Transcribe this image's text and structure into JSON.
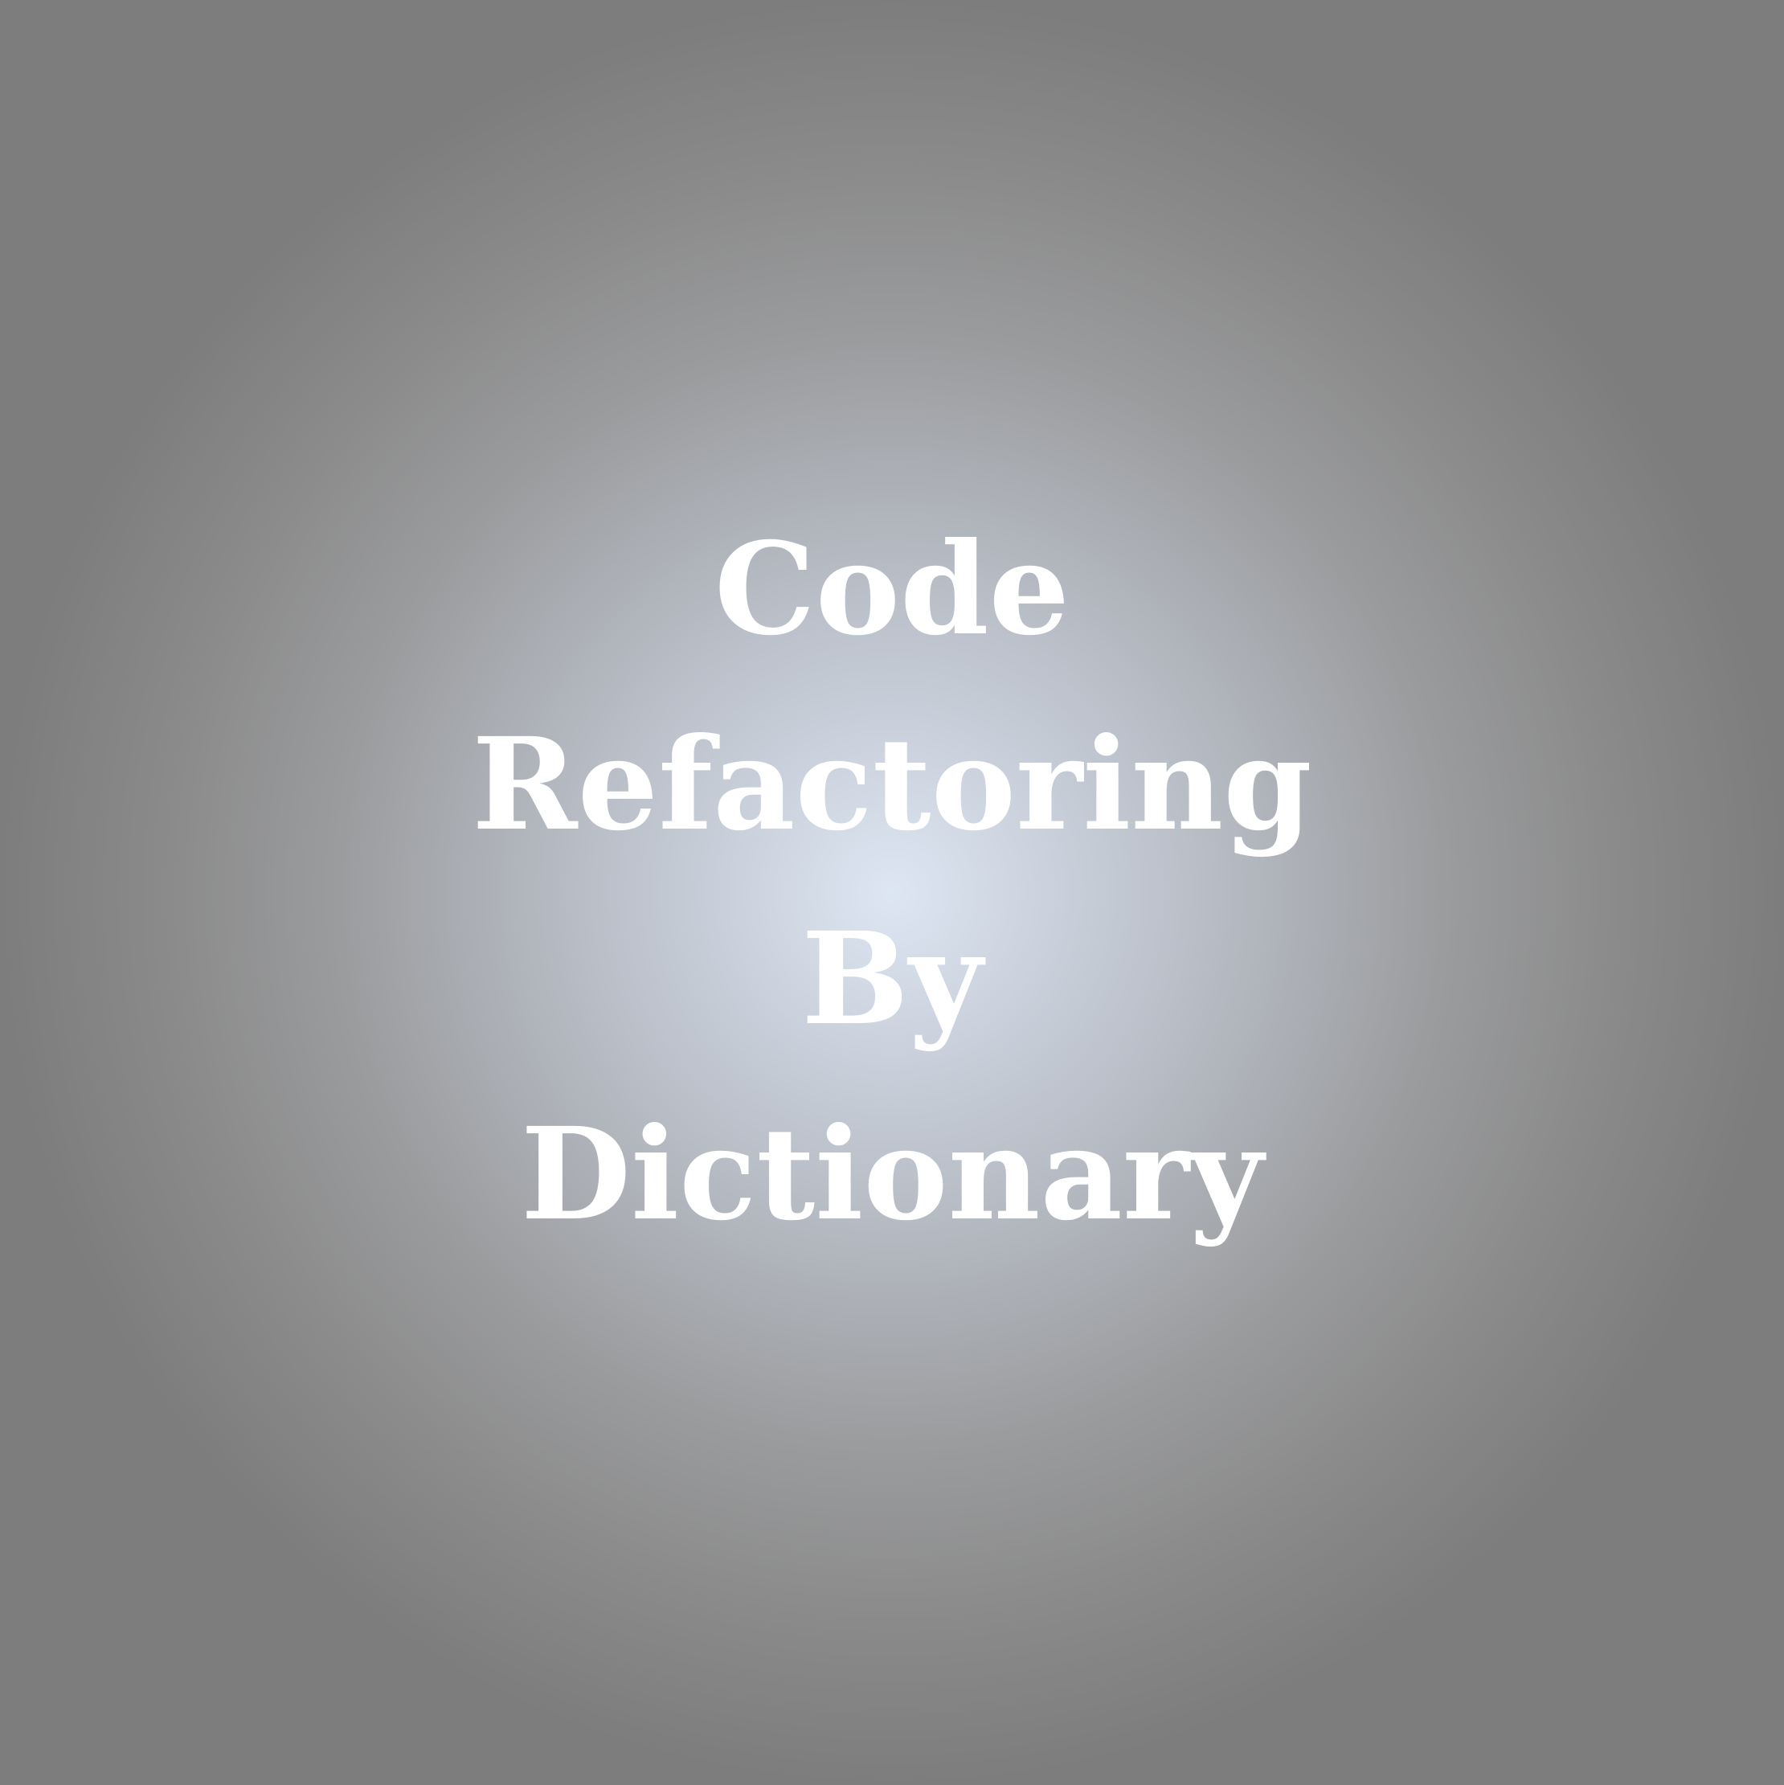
{
  "title_lines": [
    "Code",
    "Refactoring",
    "By",
    "Dictionary"
  ],
  "colors": {
    "text": "#ffffff",
    "background_center": "#dde6f3",
    "background_edge": "#7d7d7d"
  }
}
